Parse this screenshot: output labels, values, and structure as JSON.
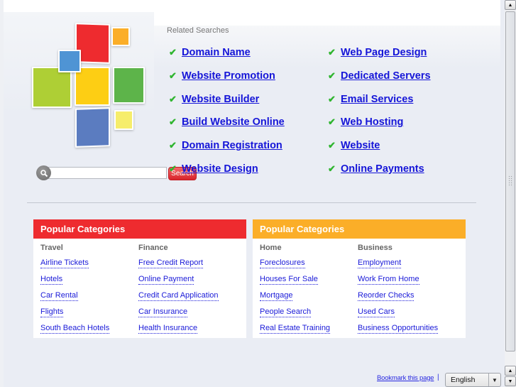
{
  "search": {
    "placeholder": "",
    "value": "",
    "button_label": "Search"
  },
  "related_searches": {
    "title": "Related Searches",
    "left": [
      "Domain Name",
      "Website Promotion",
      "Website Builder",
      "Build Website Online",
      "Domain Registration",
      "Website Design"
    ],
    "right": [
      "Web Page Design",
      "Dedicated Servers",
      "Email Services",
      "Web Hosting",
      "Website",
      "Online Payments"
    ]
  },
  "categories": [
    {
      "header": "Popular Categories",
      "color": "#ee2b2f",
      "columns": [
        {
          "title": "Travel",
          "links": [
            "Airline Tickets",
            "Hotels",
            "Car Rental",
            "Flights",
            "South Beach Hotels"
          ]
        },
        {
          "title": "Finance",
          "links": [
            "Free Credit Report",
            "Online Payment",
            "Credit Card Application",
            "Car Insurance",
            "Health Insurance"
          ]
        }
      ]
    },
    {
      "header": "Popular Categories",
      "color": "#fbae28",
      "columns": [
        {
          "title": "Home",
          "links": [
            "Foreclosures",
            "Houses For Sale",
            "Mortgage",
            "People Search",
            "Real Estate Training"
          ]
        },
        {
          "title": "Business",
          "links": [
            "Employment",
            "Work From Home",
            "Reorder Checks",
            "Used Cars",
            "Business Opportunities"
          ]
        }
      ]
    }
  ],
  "footer": {
    "bookmark_label": "Bookmark this page",
    "separator": "|",
    "language_selected": "English"
  },
  "icons": {
    "check": "✔",
    "search": "magnifier",
    "dropdown": "▼",
    "scroll_up": "▲",
    "scroll_down": "▼"
  },
  "logo_colors": {
    "red": "#ee2b2f",
    "orange": "#fbae28",
    "blue_small": "#4f94d4",
    "lime": "#aecf35",
    "yellow": "#fdce14",
    "green": "#5db44a",
    "blue": "#5b7cc0",
    "light_yellow": "#f6ed6b"
  }
}
